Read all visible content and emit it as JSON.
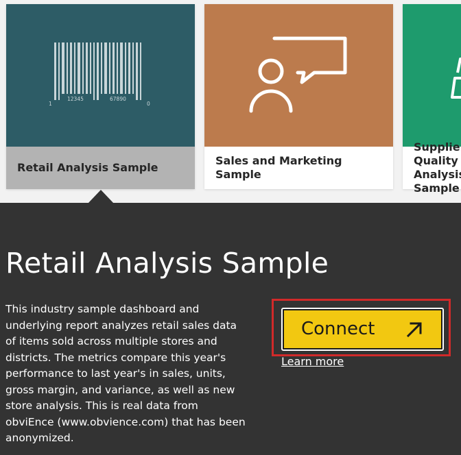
{
  "cards": [
    {
      "label": "Retail Analysis Sample",
      "color": "#2d5c66",
      "icon": "barcode-icon",
      "barcode_digits": {
        "left": "1",
        "middle_a": "12345",
        "middle_b": "67890",
        "right": "0"
      }
    },
    {
      "label": "Sales and Marketing Sample",
      "color": "#bc7b4d",
      "icon": "person-speech-icon"
    },
    {
      "label": "Supplier Quality Analysis Sample",
      "color": "#1e9b6d",
      "icon": "box-icon"
    }
  ],
  "detail": {
    "title": "Retail Analysis Sample",
    "description": "This industry sample dashboard and underlying report analyzes retail sales data of items sold across multiple stores and districts. The metrics compare this year's performance to last year's in sales, units, gross margin, and variance, as well as new store analysis. This is real data from obviEnce (www.obvience.com) that has been anonymized.",
    "connect_label": "Connect",
    "connect_icon": "arrow-up-right-icon",
    "learn_more_label": "Learn more"
  },
  "colors": {
    "panel": "#333333",
    "accent": "#f2c811",
    "highlight": "#d12a2a"
  }
}
